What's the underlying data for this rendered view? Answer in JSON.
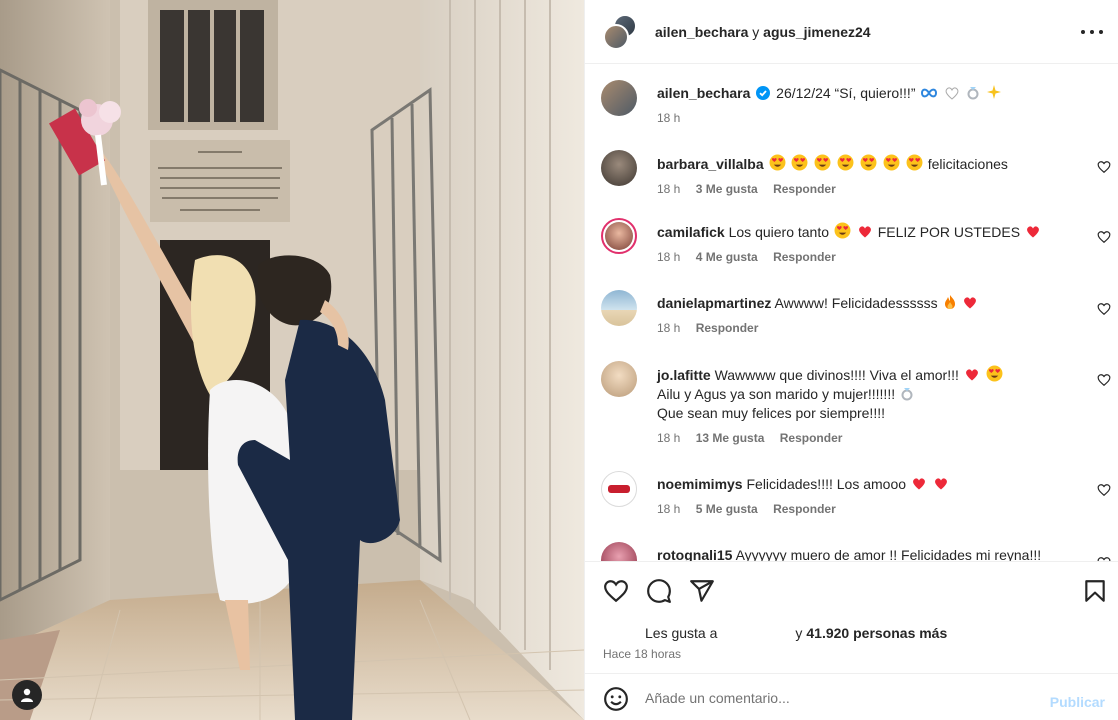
{
  "header": {
    "user1": "ailen_bechara",
    "connector": " y ",
    "user2": "agus_jimenez24",
    "more_icon": "more-horizontal-icon"
  },
  "caption": {
    "username": "ailen_bechara",
    "verified": true,
    "text": "26/12/24 “Sí, quiero!!!”",
    "emojis": [
      "infinity",
      "white-heart",
      "ring",
      "sparkles"
    ],
    "time": "18 h"
  },
  "comments": [
    {
      "username": "barbara_villalba",
      "emojis_before": [
        "heart-eyes",
        "heart-eyes",
        "heart-eyes",
        "heart-eyes",
        "heart-eyes",
        "heart-eyes",
        "heart-eyes"
      ],
      "text": "felicitaciones",
      "time": "18 h",
      "likes": "3 Me gusta",
      "reply": "Responder",
      "avatar_color": "#6b6055"
    },
    {
      "username": "camilafick",
      "text": "Los quiero tanto",
      "emojis_mid": [
        "heart-eyes",
        "red-heart"
      ],
      "text2": "FELIZ POR USTEDES",
      "emojis_end": [
        "red-heart"
      ],
      "time": "18 h",
      "likes": "4 Me gusta",
      "reply": "Responder",
      "avatar_color": "#c98a7a"
    },
    {
      "username": "danielapmartinez",
      "text": "Awwww! Felicidadessssss",
      "emojis_end": [
        "fire",
        "red-heart"
      ],
      "time": "18 h",
      "likes": "",
      "reply": "Responder",
      "avatar_color": "#7fa7c2"
    },
    {
      "username": "jo.lafitte",
      "text": "Wawwww que divinos!!!! Viva el amor!!!",
      "emojis_end": [
        "red-heart",
        "heart-eyes"
      ],
      "line2": "Ailu y Agus ya son marido y mujer!!!!!!!",
      "line2_emoji": "ring",
      "line3": "Que sean muy felices por siempre!!!!",
      "time": "18 h",
      "likes": "13 Me gusta",
      "reply": "Responder",
      "avatar_color": "#d8c2a5"
    },
    {
      "username": "noemimimys",
      "text": "Felicidades!!!! Los amooo",
      "emojis_end": [
        "red-heart",
        "red-heart"
      ],
      "time": "18 h",
      "likes": "5 Me gusta",
      "reply": "Responder",
      "avatar_color": "#ffffff"
    },
    {
      "username": "rotognali15",
      "text": "Ayyyyyy muero de amor !! Felicidades mi reyna!!!",
      "time": "",
      "likes": "",
      "reply": "",
      "avatar_color": "#c0405a"
    }
  ],
  "actions": {
    "like_icon": "heart-icon",
    "comment_icon": "comment-icon",
    "share_icon": "send-icon",
    "save_icon": "bookmark-icon"
  },
  "likes": {
    "prefix": "Les gusta a",
    "connector": "y",
    "count": "41.920 personas más"
  },
  "time_ago": "Hace 18 horas",
  "comment_box": {
    "placeholder": "Añade un comentario...",
    "publish": "Publicar"
  },
  "colors": {
    "text": "#262626",
    "muted": "#737373",
    "border": "#efefef",
    "publish_disabled": "#b3dbff",
    "verified": "#0095f6",
    "heart_red": "#ed2939"
  }
}
